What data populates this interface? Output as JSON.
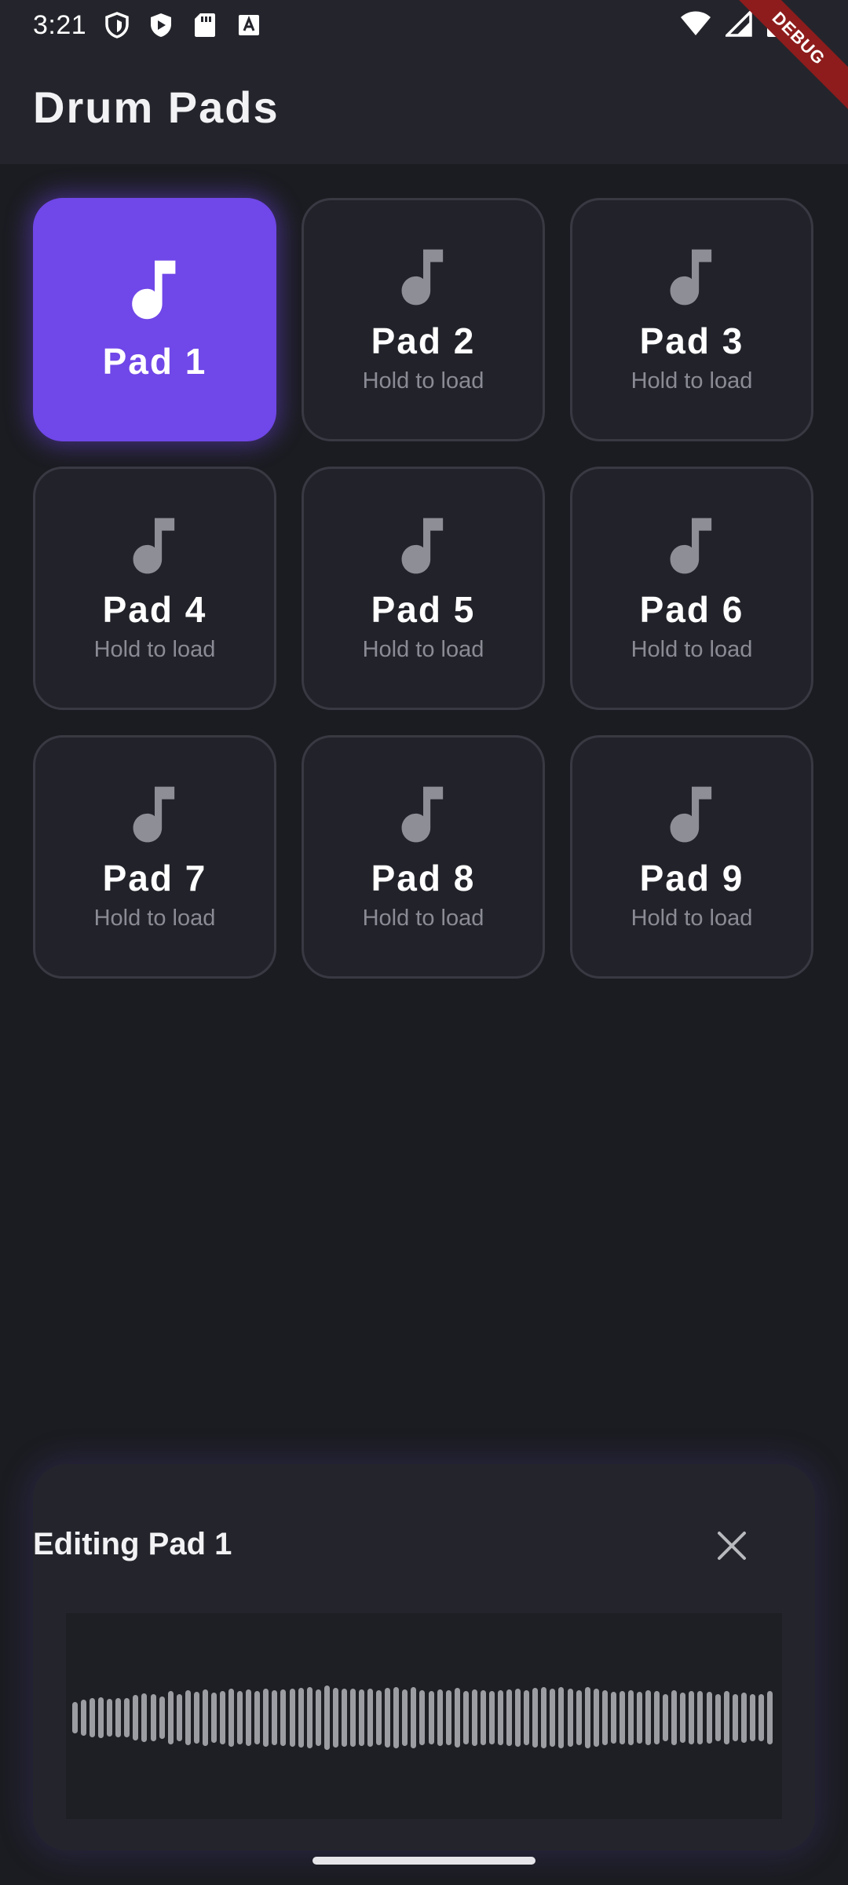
{
  "status_bar": {
    "time": "3:21",
    "left_icons": [
      "shield-icon",
      "play-icon",
      "sd-card-icon",
      "a-icon"
    ],
    "right_icons": [
      "wifi-icon",
      "signal-icon",
      "battery-icon"
    ],
    "debug_label": "DEBUG"
  },
  "app_bar": {
    "title": "Drum Pads"
  },
  "pads": [
    {
      "label": "Pad 1",
      "sub": "",
      "active": true
    },
    {
      "label": "Pad 2",
      "sub": "Hold to load",
      "active": false
    },
    {
      "label": "Pad 3",
      "sub": "Hold to load",
      "active": false
    },
    {
      "label": "Pad 4",
      "sub": "Hold to load",
      "active": false
    },
    {
      "label": "Pad 5",
      "sub": "Hold to load",
      "active": false
    },
    {
      "label": "Pad 6",
      "sub": "Hold to load",
      "active": false
    },
    {
      "label": "Pad 7",
      "sub": "Hold to load",
      "active": false
    },
    {
      "label": "Pad 8",
      "sub": "Hold to load",
      "active": false
    },
    {
      "label": "Pad 9",
      "sub": "Hold to load",
      "active": false
    }
  ],
  "edit_panel": {
    "title": "Editing Pad 1",
    "close_icon": "close-icon",
    "waveform_levels": [
      0.48,
      0.56,
      0.6,
      0.64,
      0.58,
      0.62,
      0.6,
      0.7,
      0.76,
      0.74,
      0.66,
      0.82,
      0.72,
      0.86,
      0.8,
      0.88,
      0.78,
      0.84,
      0.9,
      0.82,
      0.88,
      0.84,
      0.9,
      0.86,
      0.88,
      0.9,
      0.92,
      0.94,
      0.88,
      1.0,
      0.92,
      0.9,
      0.9,
      0.88,
      0.9,
      0.86,
      0.92,
      0.94,
      0.88,
      0.96,
      0.86,
      0.84,
      0.88,
      0.86,
      0.92,
      0.84,
      0.88,
      0.86,
      0.84,
      0.86,
      0.88,
      0.9,
      0.86,
      0.92,
      0.94,
      0.9,
      0.94,
      0.9,
      0.86,
      0.94,
      0.9,
      0.86,
      0.8,
      0.84,
      0.86,
      0.8,
      0.86,
      0.82,
      0.72,
      0.86,
      0.78,
      0.82,
      0.84,
      0.8,
      0.74,
      0.84,
      0.72,
      0.78,
      0.72,
      0.74,
      0.84
    ]
  },
  "colors": {
    "accent": "#7047e8",
    "pad_bg": "#22232a",
    "background": "#1b1c21"
  }
}
